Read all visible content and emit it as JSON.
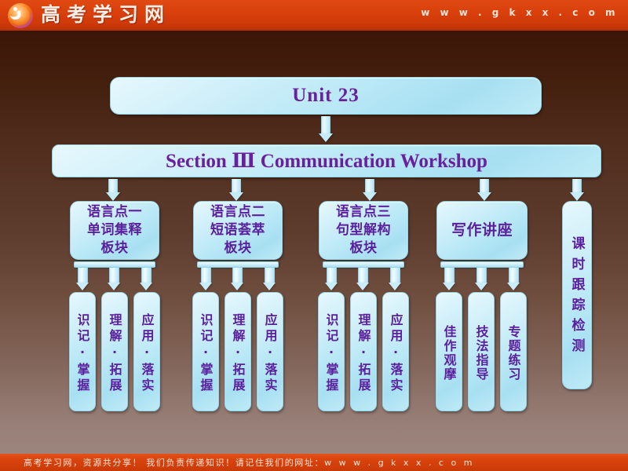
{
  "header": {
    "logo_icon": "gaokao-circle-logo-icon",
    "site_name": "高考学习网",
    "site_url": "w w w . g k x x . c o m"
  },
  "footer": {
    "text": "高考学习网，资源共分享！   我们负责传递知识！请记住我们的网址：",
    "url": "w w w . g k x x . c o m"
  },
  "colors": {
    "header_red": "#d9400c",
    "footer_red": "#d9430d",
    "box_fill": "#b9e8f6",
    "box_border": "#8fd3e8",
    "text_purple": "#5b1f9e",
    "background_top": "#2b0d04",
    "background_bottom": "#9c857d"
  },
  "diagram": {
    "unit_title": "Unit  23",
    "section_title": "Section  Ⅲ  Communication  Workshop",
    "branches": [
      {
        "id": "lang-point-1",
        "label": "语言点一\n单词集释\n板块",
        "lines": [
          "语言点一",
          "单词集释",
          "板块"
        ],
        "children": [
          "识记·掌握",
          "理解·拓展",
          "应用·落实"
        ]
      },
      {
        "id": "lang-point-2",
        "label": "语言点二\n短语荟萃\n板块",
        "lines": [
          "语言点二",
          "短语荟萃",
          "板块"
        ],
        "children": [
          "识记·掌握",
          "理解·拓展",
          "应用·落实"
        ]
      },
      {
        "id": "lang-point-3",
        "label": "语言点三\n句型解构\n板块",
        "lines": [
          "语言点三",
          "句型解构",
          "板块"
        ],
        "children": [
          "识记·掌握",
          "理解·拓展",
          "应用·落实"
        ]
      },
      {
        "id": "writing-lecture",
        "label": "写作讲座",
        "lines": [
          "写作讲座"
        ],
        "children": [
          "佳作观摩",
          "技法指导",
          "专题练习"
        ]
      },
      {
        "id": "exam-tracking",
        "label": "课时跟踪检测",
        "lines": [
          "课时跟踪检测"
        ],
        "children": []
      }
    ]
  }
}
